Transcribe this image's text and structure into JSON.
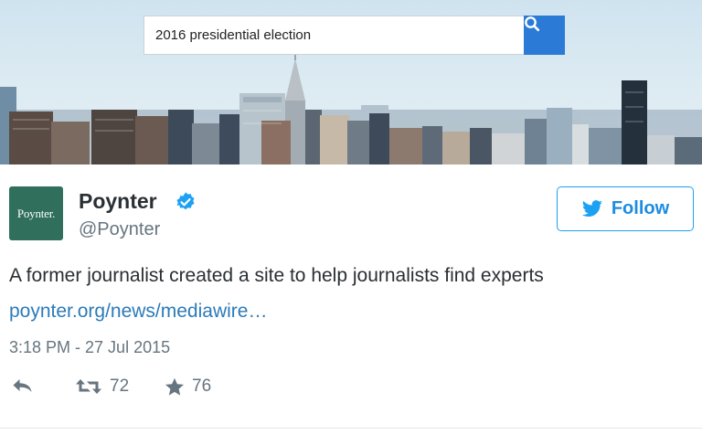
{
  "search": {
    "query": "2016 presidential election",
    "icon": "search-icon"
  },
  "tweet": {
    "avatar_text": "Poynter.",
    "display_name": "Poynter",
    "handle": "@Poynter",
    "follow_label": "Follow",
    "text": "A former journalist created a site to help journalists find experts",
    "link": "poynter.org/news/mediawire…",
    "timestamp": "3:18 PM - 27 Jul 2015",
    "retweet_count": "72",
    "favorite_count": "76"
  },
  "colors": {
    "accent": "#1da1f2",
    "link": "#2b7bb9",
    "avatar_bg": "#2f6f5b",
    "search_button": "#2b7bd6"
  }
}
